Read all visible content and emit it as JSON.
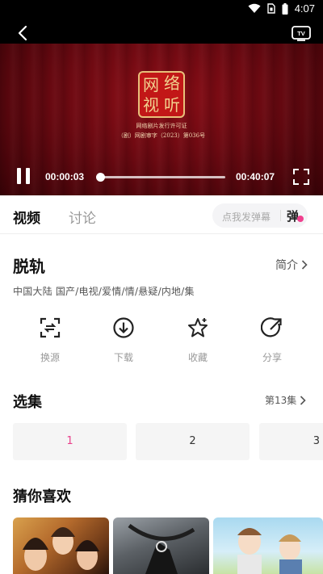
{
  "status_bar": {
    "time": "4:07",
    "icons": [
      "wifi-icon",
      "sim-card-icon",
      "battery-icon"
    ]
  },
  "player": {
    "logo_text": [
      "网",
      "络",
      "视",
      "听"
    ],
    "license_line1": "网络剧片发行许可证",
    "license_line2": "（剧）网剧审字（2023）第036号",
    "current_time": "00:00:03",
    "total_time": "00:40:07",
    "progress_fraction": 0.001
  },
  "tabs": {
    "video": "视频",
    "discuss": "讨论"
  },
  "danmaku": {
    "placeholder": "点我发弹幕",
    "toggle_label": "弹"
  },
  "show": {
    "title": "脱轨",
    "intro_label": "简介",
    "tags": "中国大陆  国产/电视/爱情/情/悬疑/内地/集"
  },
  "actions": [
    {
      "label": "换源",
      "icon": "switch-source-icon"
    },
    {
      "label": "下载",
      "icon": "download-icon"
    },
    {
      "label": "收藏",
      "icon": "star-icon"
    },
    {
      "label": "分享",
      "icon": "share-icon"
    }
  ],
  "episodes": {
    "title": "选集",
    "count_label": "第13集",
    "items": [
      "1",
      "2",
      "3"
    ],
    "selected": "1"
  },
  "recommend": {
    "title": "猜你喜欢"
  },
  "colors": {
    "accent": "#e9418b",
    "player_red": "#8c0d16"
  }
}
